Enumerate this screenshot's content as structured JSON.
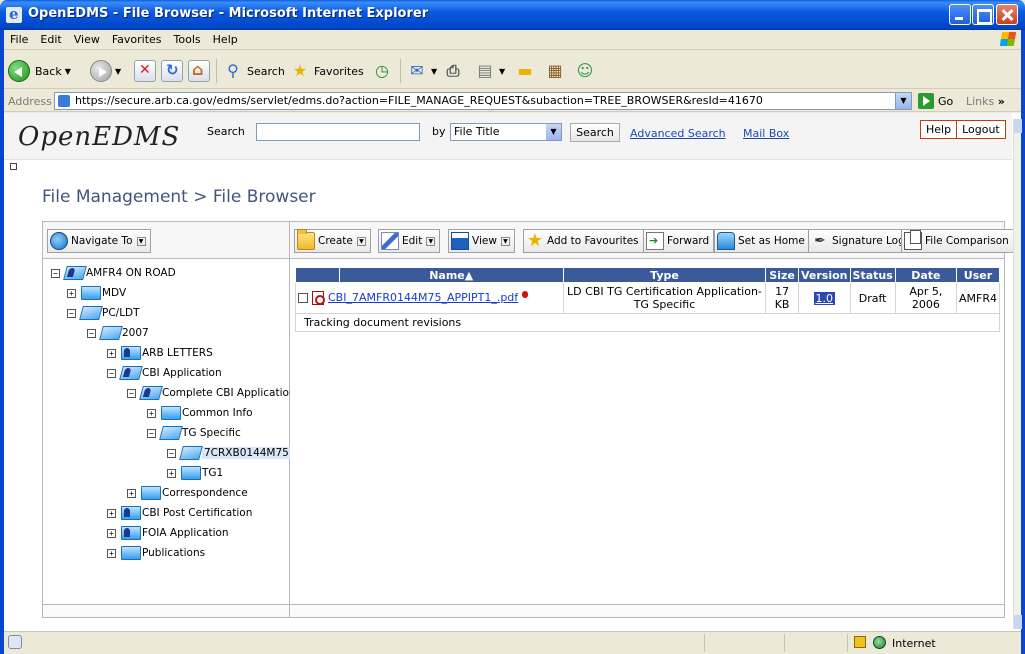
{
  "window": {
    "title": "OpenEDMS - File Browser - Microsoft Internet Explorer"
  },
  "menu": [
    "File",
    "Edit",
    "View",
    "Favorites",
    "Tools",
    "Help"
  ],
  "toolbar": {
    "back_label": "Back",
    "search_label": "Search",
    "favorites_label": "Favorites"
  },
  "address": {
    "label": "Address",
    "url": "https://secure.arb.ca.gov/edms/servlet/edms.do?action=FILE_MANAGE_REQUEST&subaction=TREE_BROWSER&resId=41670",
    "go_label": "Go",
    "links_label": "Links"
  },
  "header": {
    "logo": "OpenEDMS",
    "search_label": "Search",
    "search_value": "",
    "by_label": "by",
    "by_value": "File Title",
    "search_button": "Search",
    "advanced_search": "Advanced Search",
    "mail_box": "Mail Box",
    "help": "Help",
    "logout": "Logout"
  },
  "breadcrumb": "File Management > File Browser",
  "navigate_to": "Navigate To",
  "actions": {
    "create": "Create",
    "edit": "Edit",
    "view": "View",
    "add_fav": "Add to Favourites",
    "forward": "Forward",
    "set_home": "Set as Home",
    "sig_log": "Signature Log",
    "file_compare": "File Comparison"
  },
  "tree": [
    {
      "label": "AMFR4 ON ROAD",
      "toggle": "−"
    },
    {
      "label": "MDV",
      "toggle": "+"
    },
    {
      "label": "PC/LDT",
      "toggle": "−"
    },
    {
      "label": "2007",
      "toggle": "−"
    },
    {
      "label": "ARB LETTERS",
      "toggle": "+"
    },
    {
      "label": "CBI Application",
      "toggle": "−"
    },
    {
      "label": "Complete CBI Application",
      "toggle": "−"
    },
    {
      "label": "Common Info",
      "toggle": "+"
    },
    {
      "label": "TG Specific",
      "toggle": "−"
    },
    {
      "label": "7CRXB0144M75",
      "toggle": "−"
    },
    {
      "label": "TG1",
      "toggle": "+"
    },
    {
      "label": "Correspondence",
      "toggle": "+"
    },
    {
      "label": "CBI Post Certification",
      "toggle": "+"
    },
    {
      "label": "FOIA Application",
      "toggle": "+"
    },
    {
      "label": "Publications",
      "toggle": "+"
    }
  ],
  "table": {
    "headers": {
      "name": "Name▲",
      "type": "Type",
      "size": "Size",
      "version": "Version",
      "status": "Status",
      "date": "Date",
      "user": "User"
    },
    "rows": [
      {
        "name": "CBI_7AMFR0144M75_APPIPT1_.pdf",
        "type_line1": "LD CBI TG Certification Application-",
        "type_line2": "TG Specific",
        "size_line1": "17",
        "size_line2": "KB",
        "version": "1.0",
        "status": "Draft",
        "date_line1": "Apr 5,",
        "date_line2": "2006",
        "user": "AMFR4",
        "description": "Tracking document revisions"
      }
    ]
  },
  "status": {
    "zone": "Internet"
  }
}
